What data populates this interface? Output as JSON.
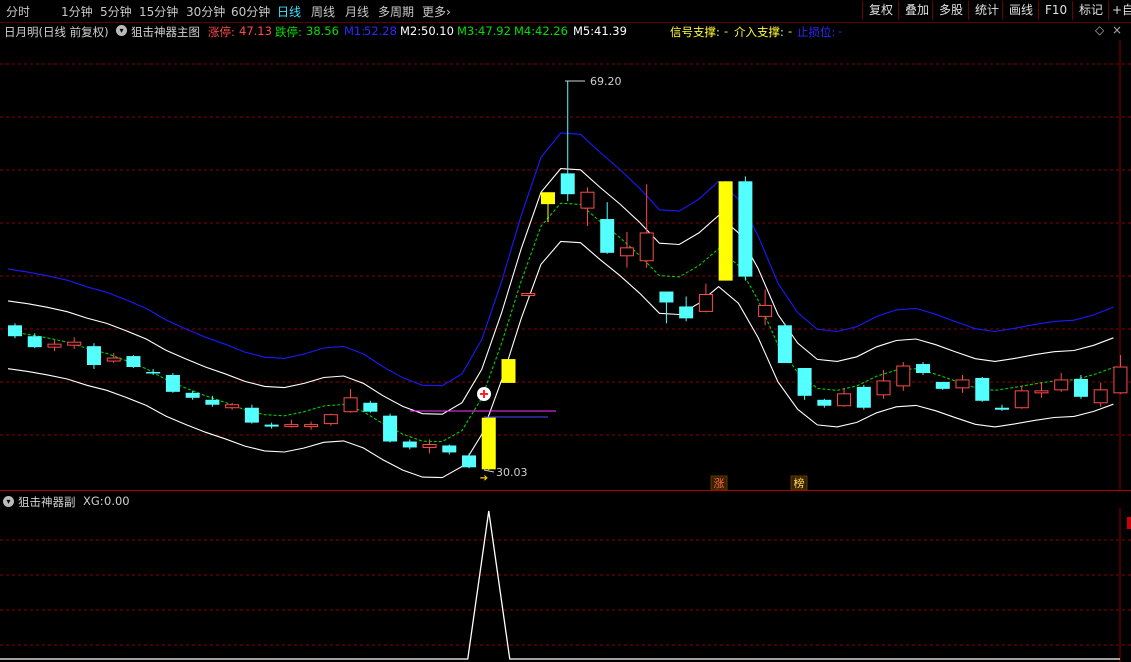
{
  "toolbar": {
    "periods": [
      "分时",
      "1分钟",
      "5分钟",
      "15分钟",
      "30分钟",
      "60分钟",
      "日线",
      "周线",
      "月线",
      "多周期",
      "更多"
    ],
    "active_period": "日线",
    "more_arrow": "›",
    "buttons": [
      "复权",
      "叠加",
      "多股",
      "统计",
      "画线",
      "F10",
      "标记",
      "+自"
    ]
  },
  "info": {
    "stock": "日月明(日线 前复权)",
    "indicator": "狙击神器主图",
    "zhangting_label": "涨停:",
    "zhangting_value": "47.13",
    "dieting_label": "跌停:",
    "dieting_value": "38.56",
    "m1_label": "M1:",
    "m1_value": "52.28",
    "m2_label": "M2:",
    "m2_value": "50.10",
    "m3_label": "M3:",
    "m3_value": "47.92",
    "m4_label": "M4:",
    "m4_value": "42.26",
    "m5_label": "M5:",
    "m5_value": "41.39",
    "signal_label": "信号支撑:",
    "signal_value": "-",
    "entry_label": "介入支撑:",
    "entry_value": "-",
    "stop_label": "止损位:",
    "stop_value": "-"
  },
  "chart_annotations": {
    "high_label": "69.20",
    "low_label": "30.03",
    "tag_zhang": "涨",
    "tag_bang": "榜"
  },
  "sub": {
    "indicator": "狙击神器副",
    "xg_label": "XG:",
    "xg_value": "0.00"
  },
  "colors": {
    "up": "#ff4a4a",
    "down": "#54ffff",
    "limit": "#ffff00",
    "band_outer": "#1a1aff",
    "band_mid": "#ffffff",
    "band_inner": "#00d000",
    "grid": "#8b0000"
  },
  "chart_data": {
    "type": "candlestick",
    "price_range": [
      30.03,
      69.2
    ],
    "candles": [
      {
        "o": 44.6,
        "h": 44.8,
        "l": 43.3,
        "c": 43.5,
        "t": "down"
      },
      {
        "o": 43.5,
        "h": 43.8,
        "l": 42.3,
        "c": 42.4,
        "t": "down"
      },
      {
        "o": 42.4,
        "h": 43.1,
        "l": 42.0,
        "c": 42.7,
        "t": "up"
      },
      {
        "o": 42.6,
        "h": 43.4,
        "l": 42.2,
        "c": 42.9,
        "t": "up"
      },
      {
        "o": 42.5,
        "h": 42.8,
        "l": 40.2,
        "c": 40.6,
        "t": "down"
      },
      {
        "o": 41.0,
        "h": 41.8,
        "l": 40.8,
        "c": 41.3,
        "t": "up"
      },
      {
        "o": 41.5,
        "h": 41.6,
        "l": 40.3,
        "c": 40.4,
        "t": "down"
      },
      {
        "o": 39.8,
        "h": 40.2,
        "l": 39.6,
        "c": 39.9,
        "t": "down"
      },
      {
        "o": 39.6,
        "h": 39.8,
        "l": 37.8,
        "c": 37.9,
        "t": "down"
      },
      {
        "o": 37.8,
        "h": 38.0,
        "l": 37.1,
        "c": 37.3,
        "t": "down"
      },
      {
        "o": 37.1,
        "h": 37.5,
        "l": 36.4,
        "c": 36.6,
        "t": "down"
      },
      {
        "o": 36.3,
        "h": 36.8,
        "l": 36.1,
        "c": 36.6,
        "t": "up"
      },
      {
        "o": 36.3,
        "h": 36.6,
        "l": 34.7,
        "c": 34.8,
        "t": "down"
      },
      {
        "o": 34.6,
        "h": 34.8,
        "l": 34.2,
        "c": 34.4,
        "t": "down"
      },
      {
        "o": 34.4,
        "h": 35.1,
        "l": 34.3,
        "c": 34.6,
        "t": "up"
      },
      {
        "o": 34.4,
        "h": 34.9,
        "l": 34.1,
        "c": 34.6,
        "t": "up"
      },
      {
        "o": 34.7,
        "h": 35.7,
        "l": 34.5,
        "c": 35.6,
        "t": "up"
      },
      {
        "o": 35.9,
        "h": 38.2,
        "l": 35.8,
        "c": 37.3,
        "t": "up"
      },
      {
        "o": 36.8,
        "h": 37.0,
        "l": 35.8,
        "c": 35.9,
        "t": "down"
      },
      {
        "o": 35.5,
        "h": 35.7,
        "l": 32.8,
        "c": 32.9,
        "t": "down"
      },
      {
        "o": 32.9,
        "h": 33.1,
        "l": 32.1,
        "c": 32.3,
        "t": "down"
      },
      {
        "o": 32.3,
        "h": 33.1,
        "l": 31.7,
        "c": 32.6,
        "t": "up"
      },
      {
        "o": 32.5,
        "h": 32.6,
        "l": 31.6,
        "c": 31.8,
        "t": "down"
      },
      {
        "o": 31.5,
        "h": 31.7,
        "l": 30.2,
        "c": 30.3,
        "t": "down"
      },
      {
        "o": 30.1,
        "h": 35.3,
        "l": 30.03,
        "c": 35.3,
        "t": "limit"
      },
      {
        "o": 38.8,
        "h": 41.2,
        "l": 38.8,
        "c": 41.2,
        "t": "limit"
      },
      {
        "o": 47.8,
        "h": 47.8,
        "l": 47.5,
        "c": 47.6,
        "t": "up"
      },
      {
        "o": 56.8,
        "h": 58.0,
        "l": 55.0,
        "c": 58.0,
        "t": "limit"
      },
      {
        "o": 59.9,
        "h": 69.2,
        "l": 57.1,
        "c": 57.8,
        "t": "down"
      },
      {
        "o": 56.4,
        "h": 58.5,
        "l": 54.6,
        "c": 58.0,
        "t": "up"
      },
      {
        "o": 55.3,
        "h": 57.0,
        "l": 51.8,
        "c": 51.9,
        "t": "down"
      },
      {
        "o": 51.6,
        "h": 54.0,
        "l": 50.4,
        "c": 52.4,
        "t": "up"
      },
      {
        "o": 51.1,
        "h": 58.8,
        "l": 50.4,
        "c": 53.9,
        "t": "up"
      },
      {
        "o": 48.0,
        "h": 48.0,
        "l": 44.8,
        "c": 46.9,
        "t": "down"
      },
      {
        "o": 46.5,
        "h": 47.5,
        "l": 45.0,
        "c": 45.3,
        "t": "down"
      },
      {
        "o": 46.0,
        "h": 48.8,
        "l": 45.9,
        "c": 47.7,
        "t": "up"
      },
      {
        "o": 49.1,
        "h": 59.1,
        "l": 49.1,
        "c": 59.1,
        "t": "limit"
      },
      {
        "o": 59.1,
        "h": 59.6,
        "l": 49.1,
        "c": 49.5,
        "t": "down"
      },
      {
        "o": 45.5,
        "h": 48.2,
        "l": 44.6,
        "c": 46.6,
        "t": "up"
      },
      {
        "o": 44.6,
        "h": 44.8,
        "l": 40.8,
        "c": 40.8,
        "t": "down"
      },
      {
        "o": 40.3,
        "h": 40.3,
        "l": 37.1,
        "c": 37.5,
        "t": "down"
      },
      {
        "o": 37.1,
        "h": 37.2,
        "l": 36.3,
        "c": 36.5,
        "t": "down"
      },
      {
        "o": 36.5,
        "h": 38.3,
        "l": 36.4,
        "c": 37.7,
        "t": "up"
      },
      {
        "o": 38.4,
        "h": 38.6,
        "l": 36.1,
        "c": 36.3,
        "t": "down"
      },
      {
        "o": 37.6,
        "h": 40.1,
        "l": 37.2,
        "c": 39.0,
        "t": "up"
      },
      {
        "o": 38.5,
        "h": 40.9,
        "l": 38.0,
        "c": 40.5,
        "t": "up"
      },
      {
        "o": 40.7,
        "h": 40.9,
        "l": 39.6,
        "c": 39.8,
        "t": "down"
      },
      {
        "o": 38.9,
        "h": 38.9,
        "l": 38.1,
        "c": 38.2,
        "t": "down"
      },
      {
        "o": 38.3,
        "h": 39.6,
        "l": 37.8,
        "c": 39.1,
        "t": "up"
      },
      {
        "o": 39.3,
        "h": 39.4,
        "l": 36.9,
        "c": 37.0,
        "t": "down"
      },
      {
        "o": 36.3,
        "h": 36.6,
        "l": 36.0,
        "c": 36.1,
        "t": "down"
      },
      {
        "o": 36.3,
        "h": 38.5,
        "l": 36.2,
        "c": 38.0,
        "t": "up"
      },
      {
        "o": 38.0,
        "h": 38.9,
        "l": 37.3,
        "c": 37.8,
        "t": "up"
      },
      {
        "o": 38.1,
        "h": 39.8,
        "l": 37.9,
        "c": 39.1,
        "t": "up"
      },
      {
        "o": 39.2,
        "h": 39.6,
        "l": 37.2,
        "c": 37.4,
        "t": "down"
      },
      {
        "o": 36.8,
        "h": 38.8,
        "l": 36.4,
        "c": 38.1,
        "t": "up"
      },
      {
        "o": 37.8,
        "h": 41.6,
        "l": 37.7,
        "c": 40.4,
        "t": "up"
      }
    ],
    "xg_signal": {
      "index": 24,
      "value": 1,
      "current": 0.0
    }
  }
}
